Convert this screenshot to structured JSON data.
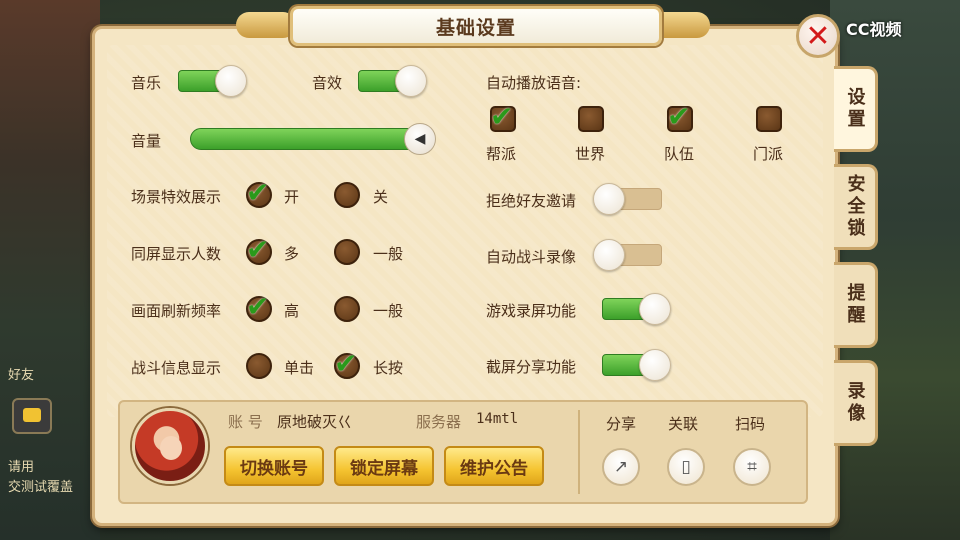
{
  "panel": {
    "title": "基础设置"
  },
  "watermark": "CC视频",
  "side_tabs": [
    "设置",
    "安全锁",
    "提醒",
    "录像"
  ],
  "audio": {
    "music_label": "音乐",
    "sfx_label": "音效",
    "volume_label": "音量",
    "music_on": true,
    "sfx_on": true,
    "volume_level": 1.0
  },
  "auto_voice": {
    "label": "自动播放语音:",
    "channels": [
      {
        "label": "帮派",
        "checked": true
      },
      {
        "label": "世界",
        "checked": false
      },
      {
        "label": "队伍",
        "checked": true
      },
      {
        "label": "门派",
        "checked": false
      }
    ]
  },
  "options": [
    {
      "label": "场景特效展示",
      "opt1": "开",
      "opt2": "关",
      "selected": 1
    },
    {
      "label": "同屏显示人数",
      "opt1": "多",
      "opt2": "一般",
      "selected": 1
    },
    {
      "label": "画面刷新频率",
      "opt1": "高",
      "opt2": "一般",
      "selected": 1
    },
    {
      "label": "战斗信息显示",
      "opt1": "单击",
      "opt2": "长按",
      "selected": 2
    }
  ],
  "toggles_right": [
    {
      "label": "拒绝好友邀请",
      "on": false
    },
    {
      "label": "自动战斗录像",
      "on": false
    },
    {
      "label": "游戏录屏功能",
      "on": true
    },
    {
      "label": "截屏分享功能",
      "on": true
    }
  ],
  "account": {
    "account_label": "账 号",
    "account_value": "原地破灭巜",
    "server_label": "服务器",
    "server_value": "14mtl"
  },
  "buttons": {
    "switch_account": "切换账号",
    "lock_screen": "锁定屏幕",
    "maintenance": "维护公告"
  },
  "share": {
    "share_label": "分享",
    "link_label": "关联",
    "scan_label": "扫码"
  },
  "background": {
    "left_text_1": "好友",
    "left_text_2": "请用",
    "left_text_3": "交测试覆盖"
  }
}
